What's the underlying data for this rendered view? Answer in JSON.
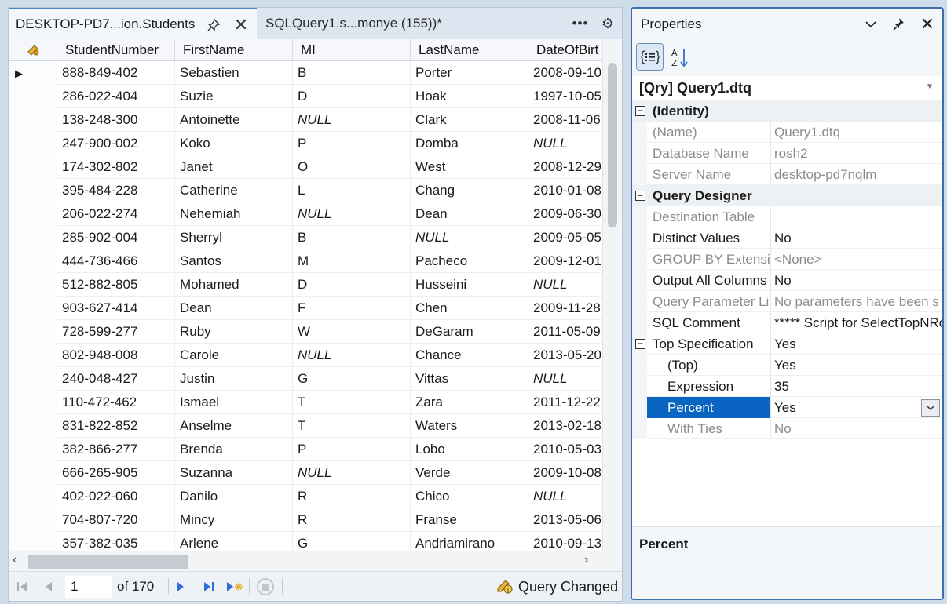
{
  "tabs": {
    "active_title": "DESKTOP-PD7...ion.Students",
    "inactive_title": "SQLQuery1.s...monye (155))*"
  },
  "grid": {
    "columns": [
      "StudentNumber",
      "FirstName",
      "MI",
      "LastName",
      "DateOfBirt"
    ],
    "rows": [
      [
        "888-849-402",
        "Sebastien",
        "B",
        "Porter",
        "2008-09-10"
      ],
      [
        "286-022-404",
        "Suzie",
        "D",
        "Hoak",
        "1997-10-05"
      ],
      [
        "138-248-300",
        "Antoinette",
        "NULL",
        "Clark",
        "2008-11-06"
      ],
      [
        "247-900-002",
        "Koko",
        "P",
        "Domba",
        "NULL"
      ],
      [
        "174-302-802",
        "Janet",
        "O",
        "West",
        "2008-12-29"
      ],
      [
        "395-484-228",
        "Catherine",
        "L",
        "Chang",
        "2010-01-08"
      ],
      [
        "206-022-274",
        "Nehemiah",
        "NULL",
        "Dean",
        "2009-06-30"
      ],
      [
        "285-902-004",
        "Sherryl",
        "B",
        "NULL",
        "2009-05-05"
      ],
      [
        "444-736-466",
        "Santos",
        "M",
        "Pacheco",
        "2009-12-01"
      ],
      [
        "512-882-805",
        "Mohamed",
        "D",
        "Husseini",
        "NULL"
      ],
      [
        "903-627-414",
        "Dean",
        "F",
        "Chen",
        "2009-11-28"
      ],
      [
        "728-599-277",
        "Ruby",
        "W",
        "DeGaram",
        "2011-05-09"
      ],
      [
        "802-948-008",
        "Carole",
        "NULL",
        "Chance",
        "2013-05-20"
      ],
      [
        "240-048-427",
        "Justin",
        "G",
        "Vittas",
        "NULL"
      ],
      [
        "110-472-462",
        "Ismael",
        "T",
        "Zara",
        "2011-12-22"
      ],
      [
        "831-822-852",
        "Anselme",
        "T",
        "Waters",
        "2013-02-18"
      ],
      [
        "382-866-277",
        "Brenda",
        "P",
        "Lobo",
        "2010-05-03"
      ],
      [
        "666-265-905",
        "Suzanna",
        "NULL",
        "Verde",
        "2009-10-08"
      ],
      [
        "402-022-060",
        "Danilo",
        "R",
        "Chico",
        "NULL"
      ],
      [
        "704-807-720",
        "Mincy",
        "R",
        "Franse",
        "2013-05-06"
      ],
      [
        "357-382-035",
        "Arlene",
        "G",
        "Andriamirano",
        "2010-09-13"
      ]
    ]
  },
  "navigation": {
    "page_value": "1",
    "of_text": "of 170",
    "status": "Query Changed"
  },
  "properties": {
    "title": "Properties",
    "object": "[Qry] Query1.dtq",
    "rows": [
      {
        "type": "category",
        "name": "(Identity)"
      },
      {
        "name": "(Name)",
        "value": "Query1.dtq",
        "readonly": true
      },
      {
        "name": "Database Name",
        "value": "rosh2",
        "readonly": true
      },
      {
        "name": "Server Name",
        "value": "desktop-pd7nqlm",
        "readonly": true
      },
      {
        "type": "category",
        "name": "Query Designer"
      },
      {
        "name": "Destination Table",
        "value": "",
        "readonly": true
      },
      {
        "name": "Distinct Values",
        "value": "No"
      },
      {
        "name": "GROUP BY Extension",
        "value": "<None>",
        "readonly": true
      },
      {
        "name": "Output All Columns",
        "value": "No"
      },
      {
        "name": "Query Parameter List",
        "value": "No parameters have been s",
        "readonly": true
      },
      {
        "name": "SQL Comment",
        "value": "***** Script for SelectTopNRows",
        "readonly": false
      },
      {
        "name": "Top Specification",
        "value": "Yes",
        "expander": true
      },
      {
        "name": "(Top)",
        "value": "Yes",
        "indent": true
      },
      {
        "name": "Expression",
        "value": "35",
        "indent": true
      },
      {
        "name": "Percent",
        "value": "Yes",
        "indent": true,
        "selected": true
      },
      {
        "name": "With Ties",
        "value": "No",
        "indent": true,
        "readonly": true
      }
    ],
    "description_title": "Percent"
  },
  "icons": {
    "pin": "pin-icon",
    "close": "close-icon",
    "more": "more-icon",
    "settings": "gear-icon",
    "categorized": "categorized-icon",
    "alphabetical": "sort-alpha-icon"
  },
  "colors": {
    "accent": "#0a64c2",
    "pane_border": "#3c6ea8",
    "nav_blue": "#2f6fd6"
  }
}
